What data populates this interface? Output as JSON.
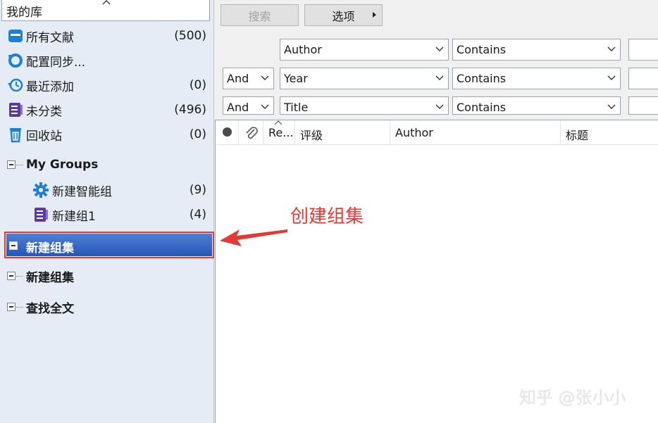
{
  "library": {
    "combo_label": "我的库",
    "items": [
      {
        "label": "所有文献",
        "count": "(500)"
      },
      {
        "label": "配置同步...",
        "count": ""
      },
      {
        "label": "最近添加",
        "count": "(0)"
      },
      {
        "label": "未分类",
        "count": "(496)"
      },
      {
        "label": "回收站",
        "count": "(0)"
      }
    ],
    "my_groups": {
      "label": "My Groups",
      "children": [
        {
          "label": "新建智能组",
          "count": "(9)"
        },
        {
          "label": "新建组1",
          "count": "(4)"
        }
      ]
    },
    "group_sets": [
      {
        "label": "新建组集",
        "selected": true
      },
      {
        "label": "新建组集",
        "selected": false
      },
      {
        "label": "查找全文",
        "selected": false
      }
    ]
  },
  "toolbar": {
    "search_label": "搜索",
    "options_label": "选项"
  },
  "search_rows": [
    {
      "connector": "",
      "field": "Author",
      "operator": "Contains"
    },
    {
      "connector": "And",
      "field": "Year",
      "operator": "Contains"
    },
    {
      "connector": "And",
      "field": "Title",
      "operator": "Contains"
    }
  ],
  "columns": {
    "ref": "Re...",
    "rating": "评级",
    "author": "Author",
    "title": "标题"
  },
  "annotation": {
    "text": "创建组集",
    "color": "#e53935"
  },
  "watermark": "知乎 @张小小",
  "colors": {
    "selection": "#2457b8",
    "panel": "#e6ecf6",
    "highlight_border": "#e53935"
  }
}
